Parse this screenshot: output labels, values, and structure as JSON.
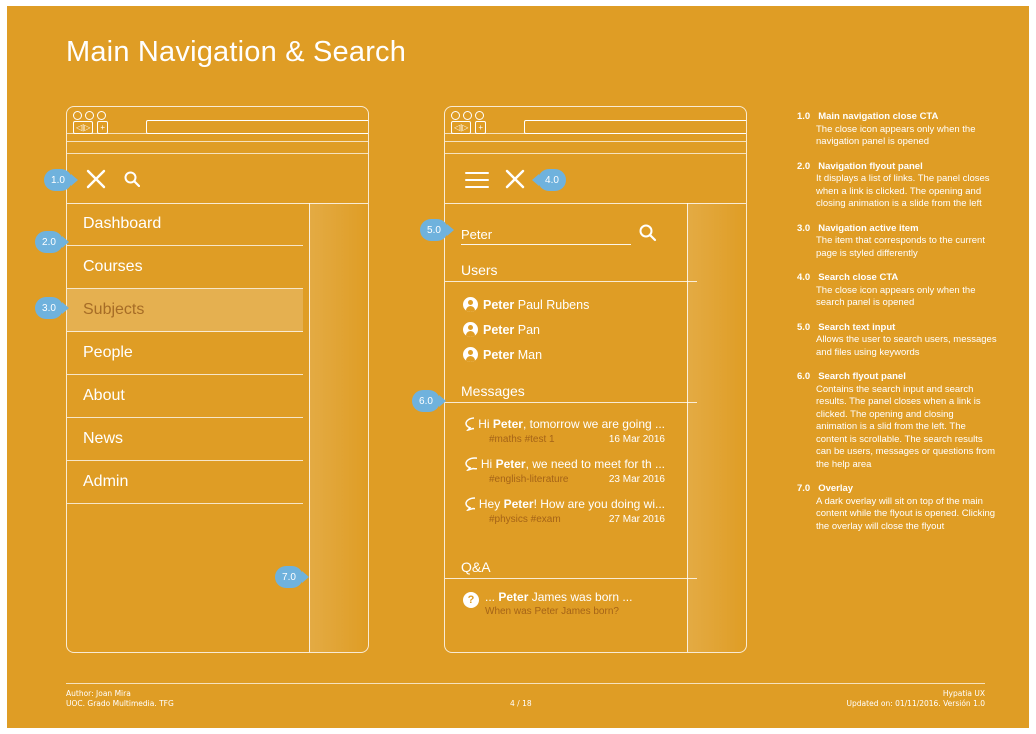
{
  "page": {
    "title": "Main Navigation & Search",
    "background": "#df9d25",
    "accent": "#6fb2dd"
  },
  "left_mock": {
    "nav_items": [
      "Dashboard",
      "Courses",
      "Subjects",
      "People",
      "About",
      "News",
      "Admin"
    ],
    "active_item": "Subjects",
    "icons": [
      "close-icon",
      "search-icon"
    ]
  },
  "right_mock": {
    "search_value": "Peter",
    "users_heading": "Users",
    "users": [
      {
        "bold": "Peter",
        "rest": " Paul Rubens"
      },
      {
        "bold": "Peter",
        "rest": " Pan"
      },
      {
        "bold": "Peter",
        "rest": " Man"
      }
    ],
    "messages_heading": "Messages",
    "messages": [
      {
        "pre": "Hi ",
        "bold": "Peter",
        "post": ", tomorrow we are going ...",
        "tags": "#maths #test 1",
        "date": "16 Mar 2016"
      },
      {
        "pre": "Hi ",
        "bold": "Peter",
        "post": ", we need to meet for th ...",
        "tags": "#english-literature",
        "date": "23 Mar 2016"
      },
      {
        "pre": "Hey ",
        "bold": "Peter",
        "post": "! How are you doing wi...",
        "tags": "#physics #exam",
        "date": "27 Mar 2016"
      }
    ],
    "qa_heading": "Q&A",
    "qa": [
      {
        "pre": "... ",
        "bold": "Peter",
        "post": " James was born ...",
        "question": "When was Peter James born?"
      }
    ],
    "icons": [
      "hamburger-icon",
      "close-icon",
      "search-icon",
      "user-icon",
      "chat-icon",
      "question-icon"
    ]
  },
  "badges": {
    "b1": "1.0",
    "b2": "2.0",
    "b3": "3.0",
    "b4": "4.0",
    "b5": "5.0",
    "b6": "6.0",
    "b7": "7.0"
  },
  "notes": [
    {
      "num": "1.0",
      "title": "Main navigation close CTA",
      "body": "The close icon appears only when the navigation panel is opened"
    },
    {
      "num": "2.0",
      "title": "Navigation flyout panel",
      "body": "It displays a list of links. The panel closes when a link is clicked. The opening and closing animation is a slide from the left"
    },
    {
      "num": "3.0",
      "title": "Navigation active item",
      "body": "The item that corresponds to the current page is styled differently"
    },
    {
      "num": "4.0",
      "title": "Search close CTA",
      "body": "The close icon appears only when the search panel is opened"
    },
    {
      "num": "5.0",
      "title": "Search text input",
      "body": "Allows the user to search users, messages and files using keywords"
    },
    {
      "num": "6.0",
      "title": "Search flyout panel",
      "body": "Contains the search input and search results. The panel closes when a link is clicked. The opening and closing animation is a slid from the left. The content is scrollable. The search results can be users, messages or questions from the help area"
    },
    {
      "num": "7.0",
      "title": "Overlay",
      "body": "A dark overlay will sit on top of the main content while the flyout is opened. Clicking the overlay will close the flyout"
    }
  ],
  "footer": {
    "author": "Author: Joan Mira",
    "org": "UOC. Grado Multimedia. TFG",
    "page": "4 / 18",
    "brand": "Hypatia UX",
    "updated": "Updated on: 01/11/2016. Versión 1.0"
  }
}
